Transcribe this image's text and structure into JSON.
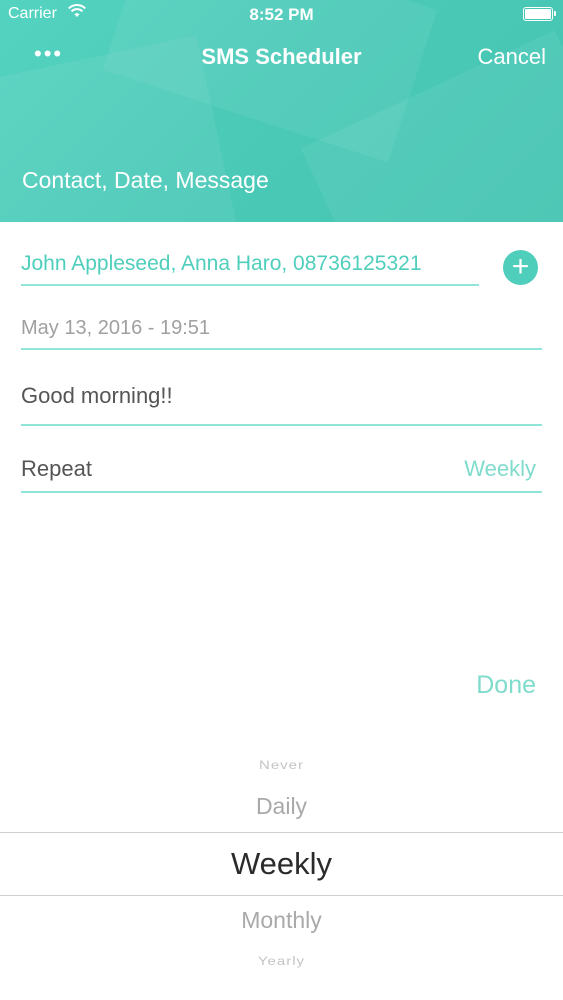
{
  "status_bar": {
    "carrier": "Carrier",
    "time": "8:52 PM"
  },
  "nav": {
    "title": "SMS Scheduler",
    "cancel_label": "Cancel",
    "menu_icon": "more-dots-icon"
  },
  "header": {
    "subtitle": "Contact, Date, Message"
  },
  "form": {
    "recipients": "John Appleseed, Anna Haro, 08736125321",
    "datetime": "May 13, 2016 - 19:51",
    "message": "Good morning!!",
    "repeat_label": "Repeat",
    "repeat_value": "Weekly"
  },
  "done_label": "Done",
  "picker": {
    "options": [
      "Never",
      "Daily",
      "Weekly",
      "Monthly",
      "Yearly"
    ],
    "selected": "Weekly"
  },
  "colors": {
    "accent": "#4fcebc",
    "accent_light": "#8fe5d8",
    "text": "#555555",
    "muted": "#a0a0a0"
  }
}
